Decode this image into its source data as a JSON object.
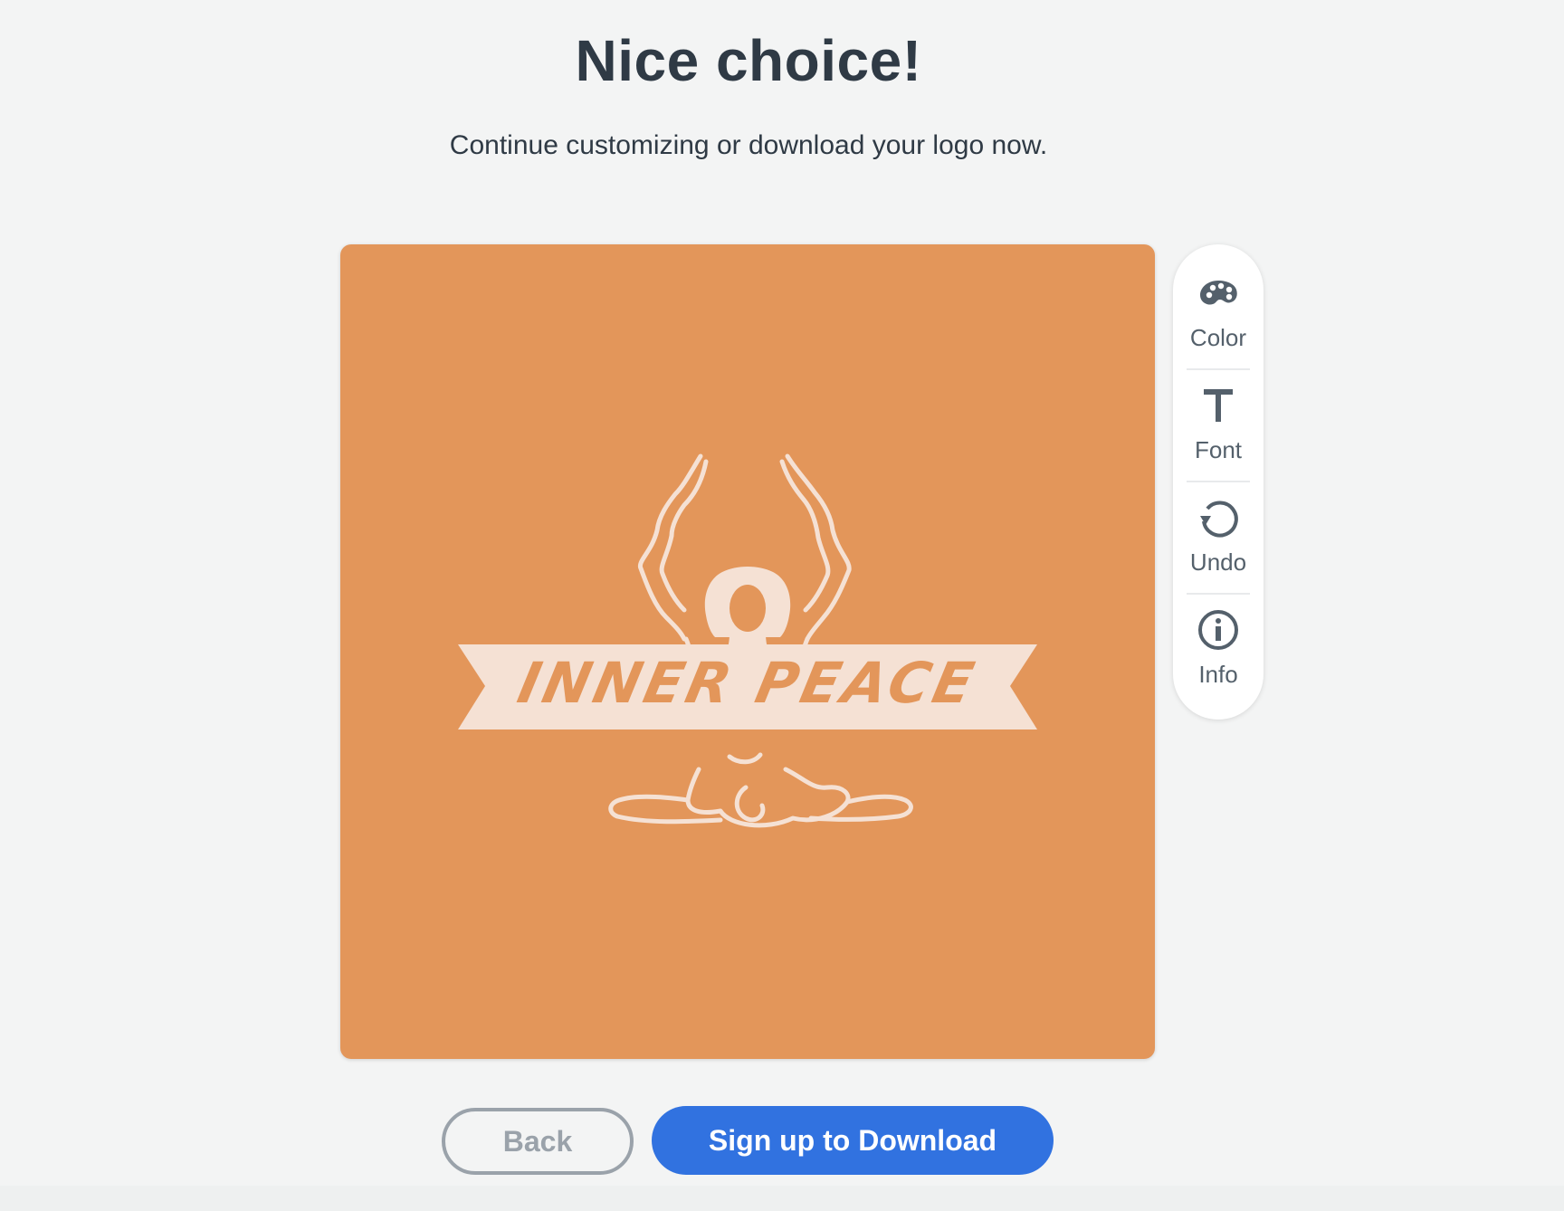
{
  "header": {
    "title": "Nice choice!",
    "subtitle": "Continue customizing or download your logo now."
  },
  "logo": {
    "text": "INNER PEACE",
    "background_color": "#e3965a",
    "foreground_color": "#f5e1d4",
    "icon": "meditating-figure-icon"
  },
  "toolbar": {
    "items": [
      {
        "label": "Color",
        "icon": "palette-icon"
      },
      {
        "label": "Font",
        "icon": "font-icon"
      },
      {
        "label": "Undo",
        "icon": "undo-icon"
      },
      {
        "label": "Info",
        "icon": "info-icon"
      }
    ]
  },
  "actions": {
    "back_label": "Back",
    "download_label": "Sign up to Download"
  },
  "colors": {
    "accent": "#3172e0",
    "text": "#2f3a45",
    "muted": "#9aa2aa"
  }
}
